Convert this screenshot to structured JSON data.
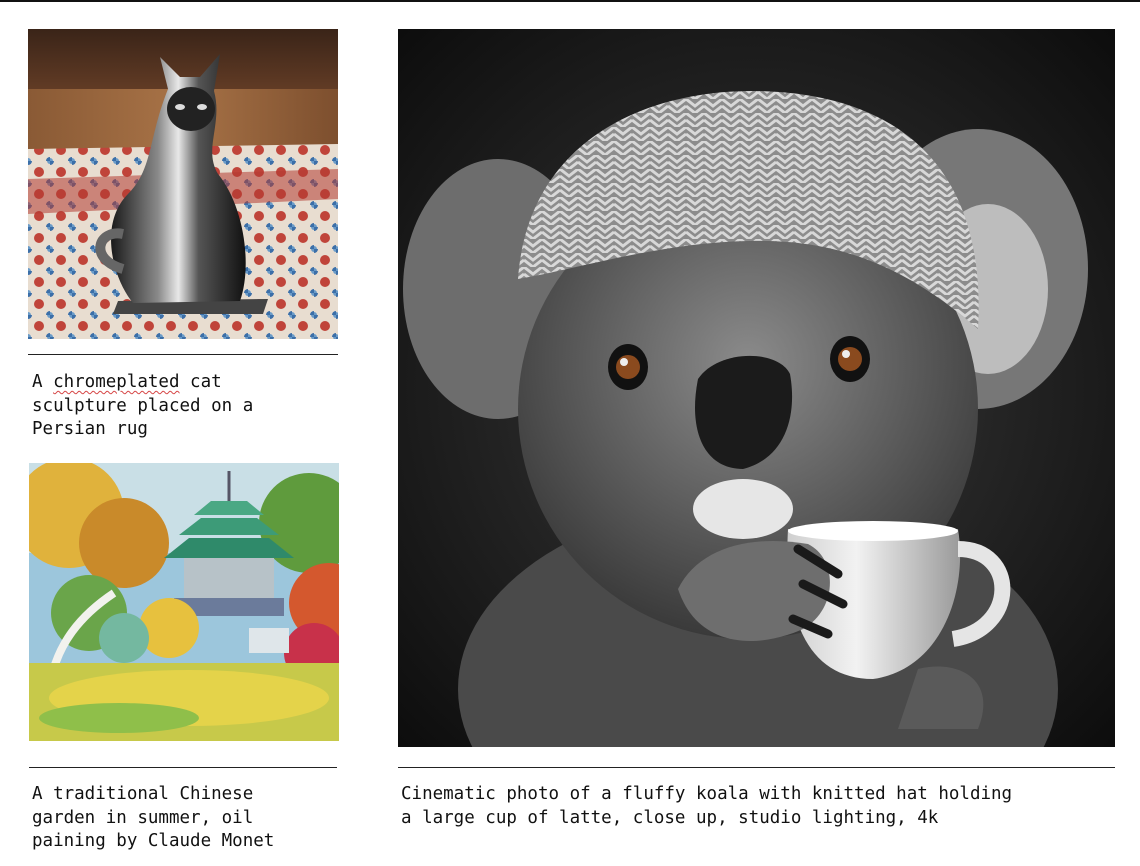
{
  "figures": [
    {
      "id": "cat",
      "image_alt": "chrome cat sculpture on a Persian rug",
      "caption_first_word": "A ",
      "caption_flagged_word": "chromeplated",
      "caption_rest": " cat\nsculpture placed on a\nPersian rug"
    },
    {
      "id": "garden",
      "image_alt": "oil painting of a traditional Chinese garden with a pagoda",
      "caption": "A traditional Chinese\ngarden in summer, oil\npaining by Claude Monet"
    },
    {
      "id": "koala",
      "image_alt": "black and white photo of a koala in a knitted hat holding a cup",
      "caption": "Cinematic photo of a fluffy koala with knitted hat holding\na large cup of latte, close up, studio lighting, 4k"
    }
  ],
  "colors": {
    "rule": "#222222",
    "spellcheck_underline": "#d64545"
  }
}
